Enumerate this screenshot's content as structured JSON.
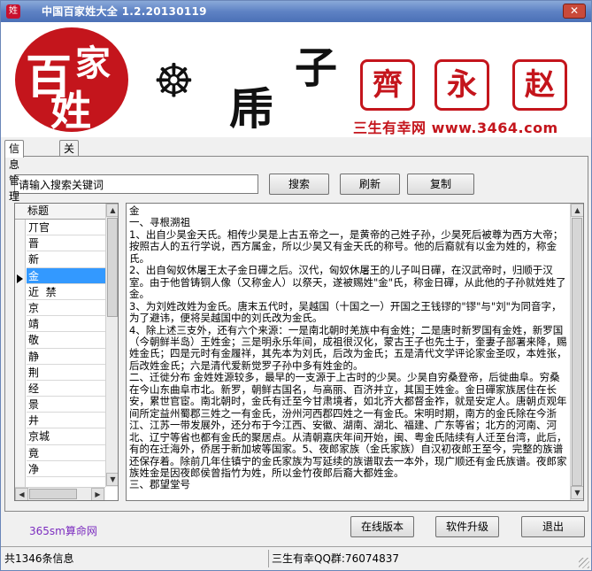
{
  "window": {
    "title": "中国百家姓大全 1.2.20130119",
    "close_label": "✕"
  },
  "banner": {
    "logo_chars": [
      "百",
      "家",
      "姓"
    ],
    "glyphs": [
      "☸",
      "乕",
      "子"
    ],
    "seals": [
      "齊",
      "永",
      "赵"
    ],
    "slogan": "三生有幸网 www.3464.com"
  },
  "tabs": [
    {
      "label": "信息管理",
      "active": true
    },
    {
      "label": "关于我们",
      "active": false
    }
  ],
  "search": {
    "value": "请输入搜索关键词",
    "search_label": "搜索",
    "refresh_label": "刷新",
    "copy_label": "复制"
  },
  "list": {
    "header": "标题",
    "selected_index": 4,
    "items": [
      "丌官",
      "晋",
      "新",
      "金",
      "近  禁",
      "京",
      "靖",
      "敬",
      "静",
      "荆",
      "经",
      "景",
      "井",
      "京城",
      "竟",
      "净"
    ]
  },
  "detail": {
    "paragraphs": [
      "金",
      "一、寻根溯祖",
      "1、出自少昊金天氏。相传少昊是上古五帝之一，是黄帝的己姓子孙，少昊死后被尊为西方大帝；按照古人的五行学说，西方属金，所以少昊又有金天氏的称号。他的后裔就有以金为姓的，称金氏。",
      "2、出自匈奴休屠王太子金日磾之后。汉代，匈奴休屠王的儿子叫日磾，在汉武帝时，归顺于汉室。由于他曾铸铜人像（又称金人）以祭天，遂被赐姓\"金\"氏，称金日磾，从此他的子孙就姓姓了金。",
      "3、为刘姓改姓为金氏。唐末五代时，吴越国（十国之一）开国之王钱镠的\"镠\"与\"刘\"为同音字，为了避讳，便将吴越国中的刘氏改为金氏。",
      "4、除上述三支外，还有六个来源：一是南北朝时羌族中有金姓；二是唐时新罗国有金姓，新罗国（今朝鲜半岛）王姓金；三是明永乐年间，成祖很汉化，蒙古王子也先土于，奎妻子部署来降，赐姓金氏；四是元时有金履祥，其先本为刘氏，后改为金氏；五是清代文学评论家金圣叹，本姓张，后改姓金氏；六是清代爱新觉罗子孙中多有姓金的。",
      "二、迁徙分布 金姓姓源较多，最早的一支源于上古时的少昊。少昊自穷桑登帝，后徙曲阜。穷桑在今山东曲阜市北。新罗，朝鲜古国名，与高丽、百济并立，其国王姓金。金日磾家族居住在长安，累世官宦。南北朝时，金氏有迁至今甘肃境者，如北齐大都督金祚，就是安定人。唐朝贞观年间所定益州蜀郡三姓之一有金氏，汾州河西郡四姓之一有金氏。宋明时期，南方的金氏除在今浙江、江苏一带发展外，还分布于今江西、安徽、湖南、湖北、福建、广东等省；北方的河南、河北、辽宁等省也都有金氏的聚居点。从清朝嘉庆年间开始，闽、粤金氏陆续有人迁至台湾，此后，有的在迁海外，侨居于新加坡等国家。5、夜郎家族（金氏家族）自汉初夜郎王至今，完整的族谱还保存着。除前几年住镇宁的金氏家族为写延续的族谱取去一本外，现广顺还有金氏族谱。夜郎家族姓金是因夜郎侯曾指竹为姓，所以金竹夜郎后裔大都姓金。",
      "三、郡望堂号"
    ]
  },
  "bottom": {
    "link": "365sm算命网",
    "online_label": "在线版本",
    "upgrade_label": "软件升级",
    "exit_label": "退出"
  },
  "status": {
    "count": "共1346条信息",
    "qq": "三生有幸QQ群:76074837"
  },
  "colors": {
    "brand_red": "#c4151c",
    "title_blue": "#5e82c4",
    "selection": "#3399ff",
    "link_purple": "#7b2cbf"
  }
}
